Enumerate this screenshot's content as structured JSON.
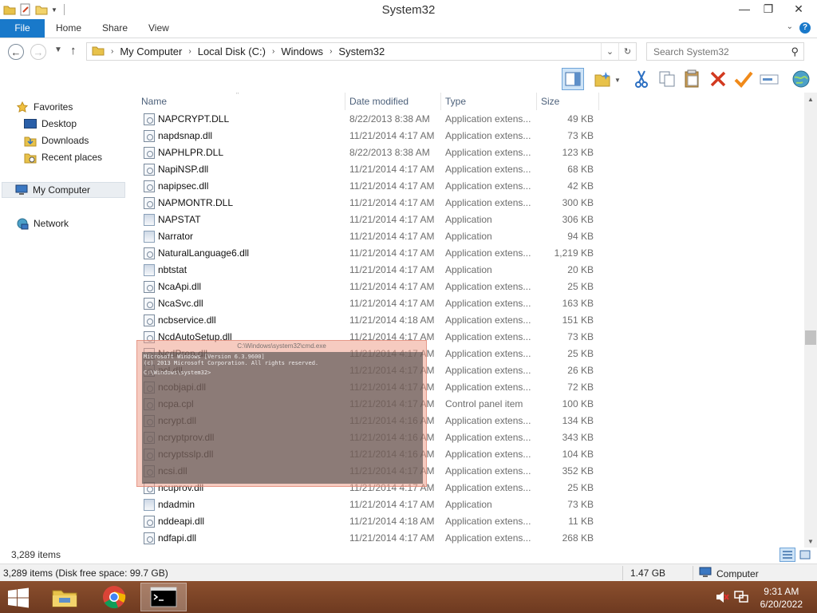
{
  "window": {
    "title": "System32",
    "controls": {
      "minimize": "—",
      "maximize": "❐",
      "close": "✕"
    }
  },
  "ribbon": {
    "tabs": [
      "File",
      "Home",
      "Share",
      "View"
    ],
    "help": "?"
  },
  "address": {
    "crumbs": [
      "My Computer",
      "Local Disk (C:)",
      "Windows",
      "System32"
    ]
  },
  "search": {
    "placeholder": "Search System32"
  },
  "toolbar": {
    "icons": [
      "details-pane-icon",
      "new-folder-icon",
      "cut-icon",
      "copy-icon",
      "paste-icon",
      "delete-icon",
      "select-icon",
      "rename-icon",
      "globe-icon"
    ]
  },
  "navpane": {
    "favorites": "Favorites",
    "desktop": "Desktop",
    "downloads": "Downloads",
    "recent": "Recent places",
    "computer": "My Computer",
    "network": "Network"
  },
  "columns": {
    "name": "Name",
    "date": "Date modified",
    "type": "Type",
    "size": "Size"
  },
  "files": [
    {
      "name": "NAPCRYPT.DLL",
      "date": "8/22/2013 8:38 AM",
      "type": "Application extens...",
      "size": "49 KB",
      "kind": "dll"
    },
    {
      "name": "napdsnap.dll",
      "date": "11/21/2014 4:17 AM",
      "type": "Application extens...",
      "size": "73 KB",
      "kind": "dll"
    },
    {
      "name": "NAPHLPR.DLL",
      "date": "8/22/2013 8:38 AM",
      "type": "Application extens...",
      "size": "123 KB",
      "kind": "dll"
    },
    {
      "name": "NapiNSP.dll",
      "date": "11/21/2014 4:17 AM",
      "type": "Application extens...",
      "size": "68 KB",
      "kind": "dll"
    },
    {
      "name": "napipsec.dll",
      "date": "11/21/2014 4:17 AM",
      "type": "Application extens...",
      "size": "42 KB",
      "kind": "dll"
    },
    {
      "name": "NAPMONTR.DLL",
      "date": "11/21/2014 4:17 AM",
      "type": "Application extens...",
      "size": "300 KB",
      "kind": "dll"
    },
    {
      "name": "NAPSTAT",
      "date": "11/21/2014 4:17 AM",
      "type": "Application",
      "size": "306 KB",
      "kind": "app"
    },
    {
      "name": "Narrator",
      "date": "11/21/2014 4:17 AM",
      "type": "Application",
      "size": "94 KB",
      "kind": "app"
    },
    {
      "name": "NaturalLanguage6.dll",
      "date": "11/21/2014 4:17 AM",
      "type": "Application extens...",
      "size": "1,219 KB",
      "kind": "dll"
    },
    {
      "name": "nbtstat",
      "date": "11/21/2014 4:17 AM",
      "type": "Application",
      "size": "20 KB",
      "kind": "app"
    },
    {
      "name": "NcaApi.dll",
      "date": "11/21/2014 4:17 AM",
      "type": "Application extens...",
      "size": "25 KB",
      "kind": "dll"
    },
    {
      "name": "NcaSvc.dll",
      "date": "11/21/2014 4:17 AM",
      "type": "Application extens...",
      "size": "163 KB",
      "kind": "dll"
    },
    {
      "name": "ncbservice.dll",
      "date": "11/21/2014 4:18 AM",
      "type": "Application extens...",
      "size": "151 KB",
      "kind": "dll"
    },
    {
      "name": "NcdAutoSetup.dll",
      "date": "11/21/2014 4:17 AM",
      "type": "Application extens...",
      "size": "73 KB",
      "kind": "dll"
    },
    {
      "name": "NcdProp.dll",
      "date": "11/21/2014 4:17 AM",
      "type": "Application extens...",
      "size": "25 KB",
      "kind": "dll"
    },
    {
      "name": "ncl.dll",
      "date": "11/21/2014 4:17 AM",
      "type": "Application extens...",
      "size": "26 KB",
      "kind": "dll"
    },
    {
      "name": "ncobjapi.dll",
      "date": "11/21/2014 4:17 AM",
      "type": "Application extens...",
      "size": "72 KB",
      "kind": "dll"
    },
    {
      "name": "ncpa.cpl",
      "date": "11/21/2014 4:17 AM",
      "type": "Control panel item",
      "size": "100 KB",
      "kind": "dll"
    },
    {
      "name": "ncrypt.dll",
      "date": "11/21/2014 4:16 AM",
      "type": "Application extens...",
      "size": "134 KB",
      "kind": "dll"
    },
    {
      "name": "ncryptprov.dll",
      "date": "11/21/2014 4:16 AM",
      "type": "Application extens...",
      "size": "343 KB",
      "kind": "dll"
    },
    {
      "name": "ncryptsslp.dll",
      "date": "11/21/2014 4:16 AM",
      "type": "Application extens...",
      "size": "104 KB",
      "kind": "dll"
    },
    {
      "name": "ncsi.dll",
      "date": "11/21/2014 4:17 AM",
      "type": "Application extens...",
      "size": "352 KB",
      "kind": "dll"
    },
    {
      "name": "ncuprov.dll",
      "date": "11/21/2014 4:17 AM",
      "type": "Application extens...",
      "size": "25 KB",
      "kind": "dll"
    },
    {
      "name": "ndadmin",
      "date": "11/21/2014 4:17 AM",
      "type": "Application",
      "size": "73 KB",
      "kind": "app"
    },
    {
      "name": "nddeapi.dll",
      "date": "11/21/2014 4:18 AM",
      "type": "Application extens...",
      "size": "11 KB",
      "kind": "dll"
    },
    {
      "name": "ndfapi.dll",
      "date": "11/21/2014 4:17 AM",
      "type": "Application extens...",
      "size": "268 KB",
      "kind": "dll"
    }
  ],
  "ghost_window": {
    "title": "C:\\Windows\\system32\\cmd.exe",
    "lines": [
      "Microsoft Windows [Version 6.3.9600]",
      "(c) 2013 Microsoft Corporation. All rights reserved.",
      "C:\\Windows\\system32>"
    ]
  },
  "status": {
    "items": "3,289 items",
    "detail": "3,289 items (Disk free space: 99.7 GB)",
    "size": "1.47 GB",
    "location": "Computer"
  },
  "taskbar": {
    "time": "9:31 AM",
    "date": "6/20/2022"
  },
  "colors": {
    "accent": "#1979ca",
    "taskbar": "#7a4226"
  }
}
